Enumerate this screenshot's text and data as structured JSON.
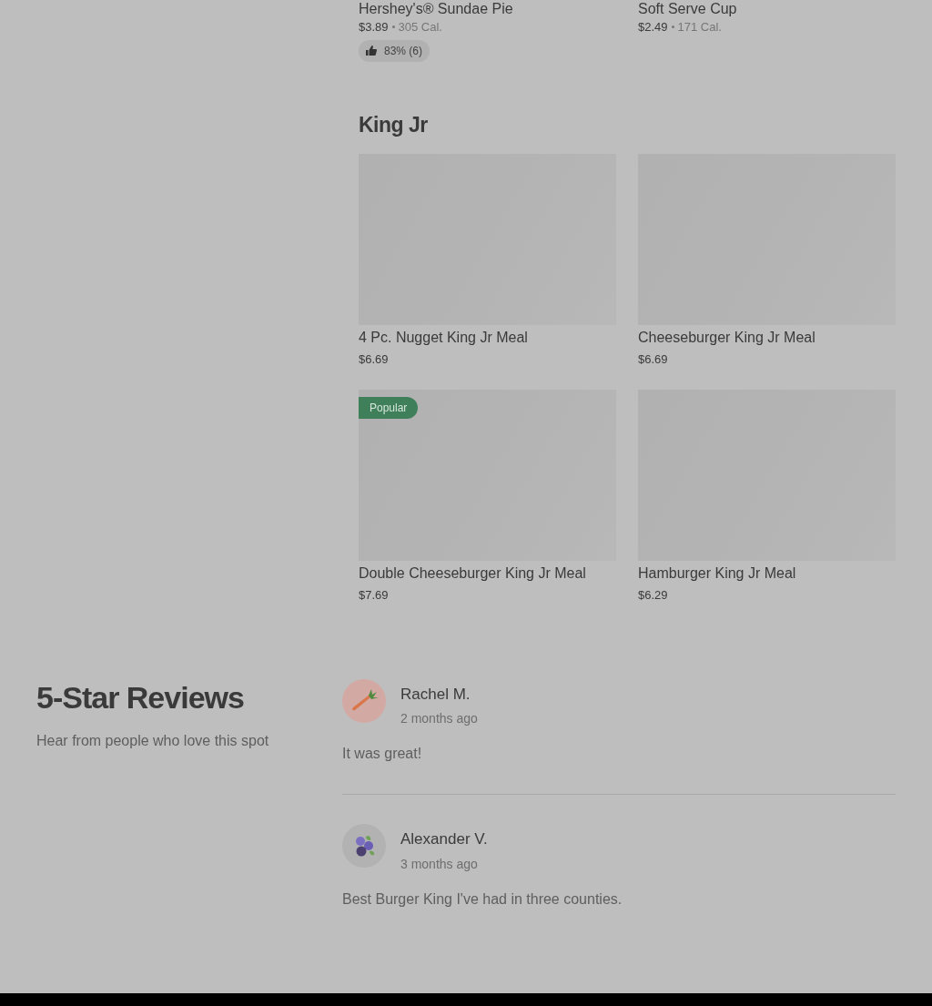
{
  "top_items": [
    {
      "name": "Hershey's® Sundae Pie",
      "price": "$3.89",
      "calories": "305 Cal.",
      "rating": "83% (6)"
    },
    {
      "name": "Soft Serve Cup",
      "price": "$2.49",
      "calories": "171 Cal."
    }
  ],
  "section": {
    "title": "King Jr",
    "items": [
      {
        "name": "4 Pc. Nugget King Jr Meal",
        "price": "$6.69"
      },
      {
        "name": "Cheeseburger King Jr Meal",
        "price": "$6.69"
      },
      {
        "name": "Double Cheeseburger King Jr Meal",
        "price": "$7.69",
        "badge": "Popular"
      },
      {
        "name": "Hamburger King Jr Meal",
        "price": "$6.29"
      }
    ]
  },
  "reviews": {
    "title": "5-Star Reviews",
    "subtitle": "Hear from people who love this spot",
    "items": [
      {
        "author": "Rachel M.",
        "time": "2 months ago",
        "text": "It was great!",
        "kind": "carrot"
      },
      {
        "author": "Alexander V.",
        "time": "3 months ago",
        "text": "Best Burger King I've had in three counties.",
        "kind": "blueberry"
      }
    ]
  }
}
